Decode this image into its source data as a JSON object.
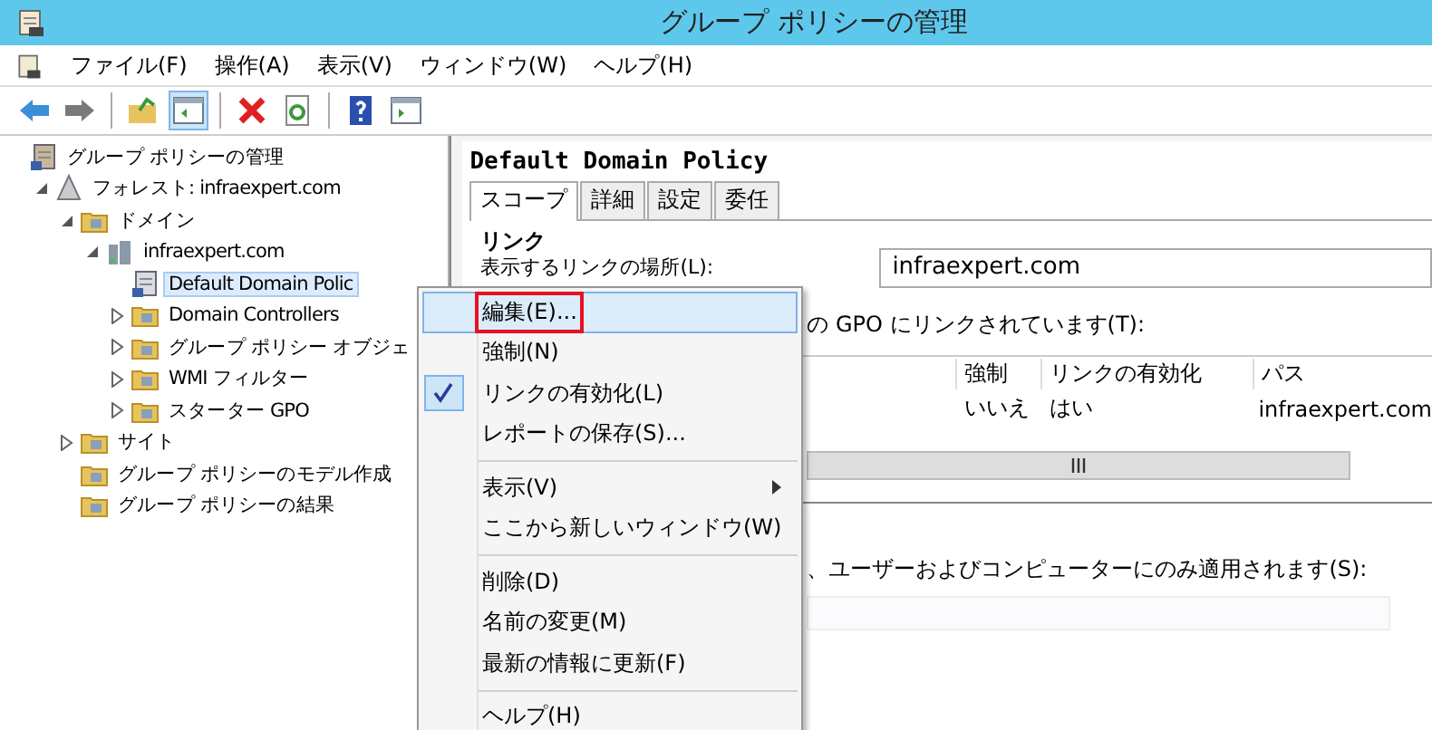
{
  "window": {
    "title": "グループ ポリシーの管理"
  },
  "menu_bar": [
    "ファイル(F)",
    "操作(A)",
    "表示(V)",
    "ウィンドウ(W)",
    "ヘルプ(H)"
  ],
  "toolbar": [
    {
      "kind": "back",
      "pressed": false
    },
    {
      "kind": "forward",
      "pressed": false
    },
    {
      "kind": "sep"
    },
    {
      "kind": "up",
      "pressed": false
    },
    {
      "kind": "pane",
      "pressed": true
    },
    {
      "kind": "sep"
    },
    {
      "kind": "delete",
      "pressed": false
    },
    {
      "kind": "refresh",
      "pressed": false
    },
    {
      "kind": "sep"
    },
    {
      "kind": "help",
      "pressed": false
    },
    {
      "kind": "action",
      "pressed": false
    }
  ],
  "tree": [
    {
      "label": "グループ ポリシーの管理",
      "kind": "root",
      "selected": false,
      "children": [
        {
          "label": "フォレスト: infraexpert.com",
          "kind": "forest",
          "expanded": true,
          "selected": false,
          "children": [
            {
              "label": "ドメイン",
              "kind": "folder",
              "expanded": true,
              "selected": false,
              "children": [
                {
                  "label": "infraexpert.com",
                  "kind": "domain",
                  "expanded": true,
                  "selected": false,
                  "children": [
                    {
                      "label": "Default Domain Polic",
                      "kind": "gpo",
                      "selected": true
                    },
                    {
                      "label": "Domain Controllers",
                      "kind": "folder",
                      "expanded": false,
                      "selected": false
                    },
                    {
                      "label": "グループ ポリシー オブジェ",
                      "kind": "folder",
                      "expanded": false,
                      "selected": false
                    },
                    {
                      "label": "WMI フィルター",
                      "kind": "folder",
                      "expanded": false,
                      "selected": false
                    },
                    {
                      "label": "スターター GPO",
                      "kind": "folder",
                      "expanded": false,
                      "selected": false
                    }
                  ]
                }
              ]
            },
            {
              "label": "サイト",
              "kind": "folder",
              "expanded": false,
              "selected": false
            },
            {
              "label": "グループ ポリシーのモデル作成",
              "kind": "folder",
              "selected": false
            },
            {
              "label": "グループ ポリシーの結果",
              "kind": "folder",
              "selected": false
            }
          ]
        }
      ]
    }
  ],
  "details": {
    "title": "Default Domain Policy",
    "tabs": [
      {
        "label": "スコープ",
        "selected": true
      },
      {
        "label": "詳細",
        "selected": false
      },
      {
        "label": "設定",
        "selected": false
      },
      {
        "label": "委任",
        "selected": false
      }
    ],
    "section": "リンク",
    "location_label": "表示するリンクの場所(L):",
    "location_value": "infraexpert.com",
    "linked_label": "の GPO にリンクされています(T):",
    "table": {
      "columns": [
        "強制",
        "リンクの有効化",
        "パス"
      ],
      "rows": [
        [
          "いいえ",
          "はい",
          "infraexpert.com"
        ]
      ]
    },
    "filter_label": "、ユーザーおよびコンピューターにのみ適用されます(S):"
  },
  "context_menu": [
    {
      "kind": "item",
      "label": "編集(E)...",
      "selected": true,
      "boxed": true,
      "checked": false,
      "submenu": false
    },
    {
      "kind": "item",
      "label": "強制(N)",
      "selected": false,
      "boxed": false,
      "checked": false,
      "submenu": false
    },
    {
      "kind": "item",
      "label": "リンクの有効化(L)",
      "selected": false,
      "boxed": false,
      "checked": true,
      "submenu": false
    },
    {
      "kind": "item",
      "label": "レポートの保存(S)...",
      "selected": false,
      "boxed": false,
      "checked": false,
      "submenu": false
    },
    {
      "kind": "separator"
    },
    {
      "kind": "item",
      "label": "表示(V)",
      "selected": false,
      "boxed": false,
      "checked": false,
      "submenu": true
    },
    {
      "kind": "item",
      "label": "ここから新しいウィンドウ(W)",
      "selected": false,
      "boxed": false,
      "checked": false,
      "submenu": false
    },
    {
      "kind": "separator"
    },
    {
      "kind": "item",
      "label": "削除(D)",
      "selected": false,
      "boxed": false,
      "checked": false,
      "submenu": false
    },
    {
      "kind": "item",
      "label": "名前の変更(M)",
      "selected": false,
      "boxed": false,
      "checked": false,
      "submenu": false
    },
    {
      "kind": "item",
      "label": "最新の情報に更新(F)",
      "selected": false,
      "boxed": false,
      "checked": false,
      "submenu": false
    },
    {
      "kind": "separator"
    },
    {
      "kind": "item",
      "label": "ヘルプ(H)",
      "selected": false,
      "boxed": false,
      "checked": false,
      "submenu": false
    }
  ]
}
